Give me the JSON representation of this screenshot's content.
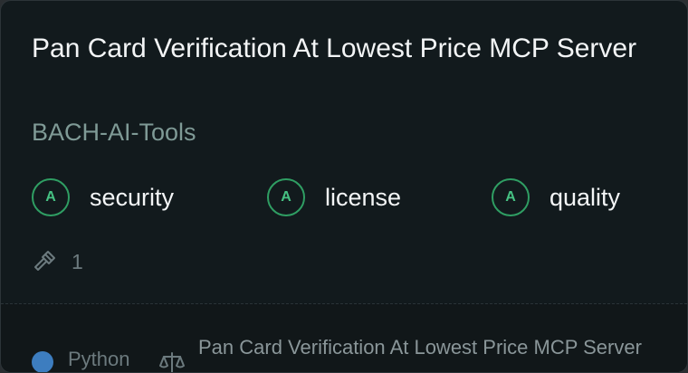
{
  "card": {
    "title": "Pan Card Verification At Lowest Price MCP Server",
    "owner": "BACH-AI-Tools",
    "scores": [
      {
        "grade": "A",
        "label": "security"
      },
      {
        "grade": "A",
        "label": "license"
      },
      {
        "grade": "A",
        "label": "quality"
      }
    ],
    "tools_count": "1",
    "language": "Python",
    "description": "Pan Card Verification At Lowest Price MCP Server"
  },
  "colors": {
    "accent_green": "#46c283",
    "language_dot": "#3d7dbf",
    "background": "#121a1d"
  },
  "icons": {
    "tools": "hammer-icon",
    "license": "scale-icon"
  }
}
